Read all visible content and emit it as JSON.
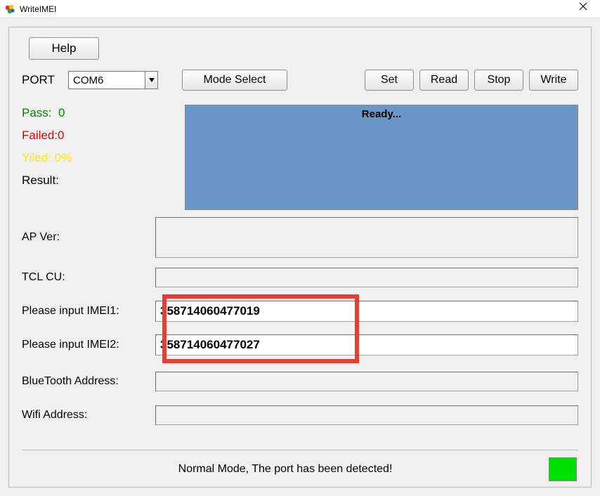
{
  "window": {
    "title": "WriteIMEI"
  },
  "help_button_label": "Help",
  "port": {
    "label": "PORT",
    "selected_value": "COM6"
  },
  "buttons": {
    "mode_select": "Mode Select",
    "set": "Set",
    "read": "Read",
    "stop": "Stop",
    "write": "Write"
  },
  "status": {
    "pass_label": "Pass:",
    "pass_value": "0",
    "failed_label": "Failed:",
    "failed_value": "0",
    "yiled_label": "Yiled:",
    "yiled_value": "0%",
    "result_label": "Result:",
    "ready_text": "Ready..."
  },
  "fields": {
    "ap_ver_label": "AP Ver:",
    "ap_ver_value": "",
    "tcl_cu_label": "TCL CU:",
    "tcl_cu_value": "",
    "imei1_label": "Please input IMEI1:",
    "imei1_value": "358714060477019",
    "imei2_label": "Please input IMEI2:",
    "imei2_value": "358714060477027",
    "bluetooth_label": "BlueTooth Address:",
    "bluetooth_value": "",
    "wifi_label": "Wifi Address:",
    "wifi_value": ""
  },
  "footer": {
    "status_text": "Normal Mode, The port has been detected!"
  }
}
